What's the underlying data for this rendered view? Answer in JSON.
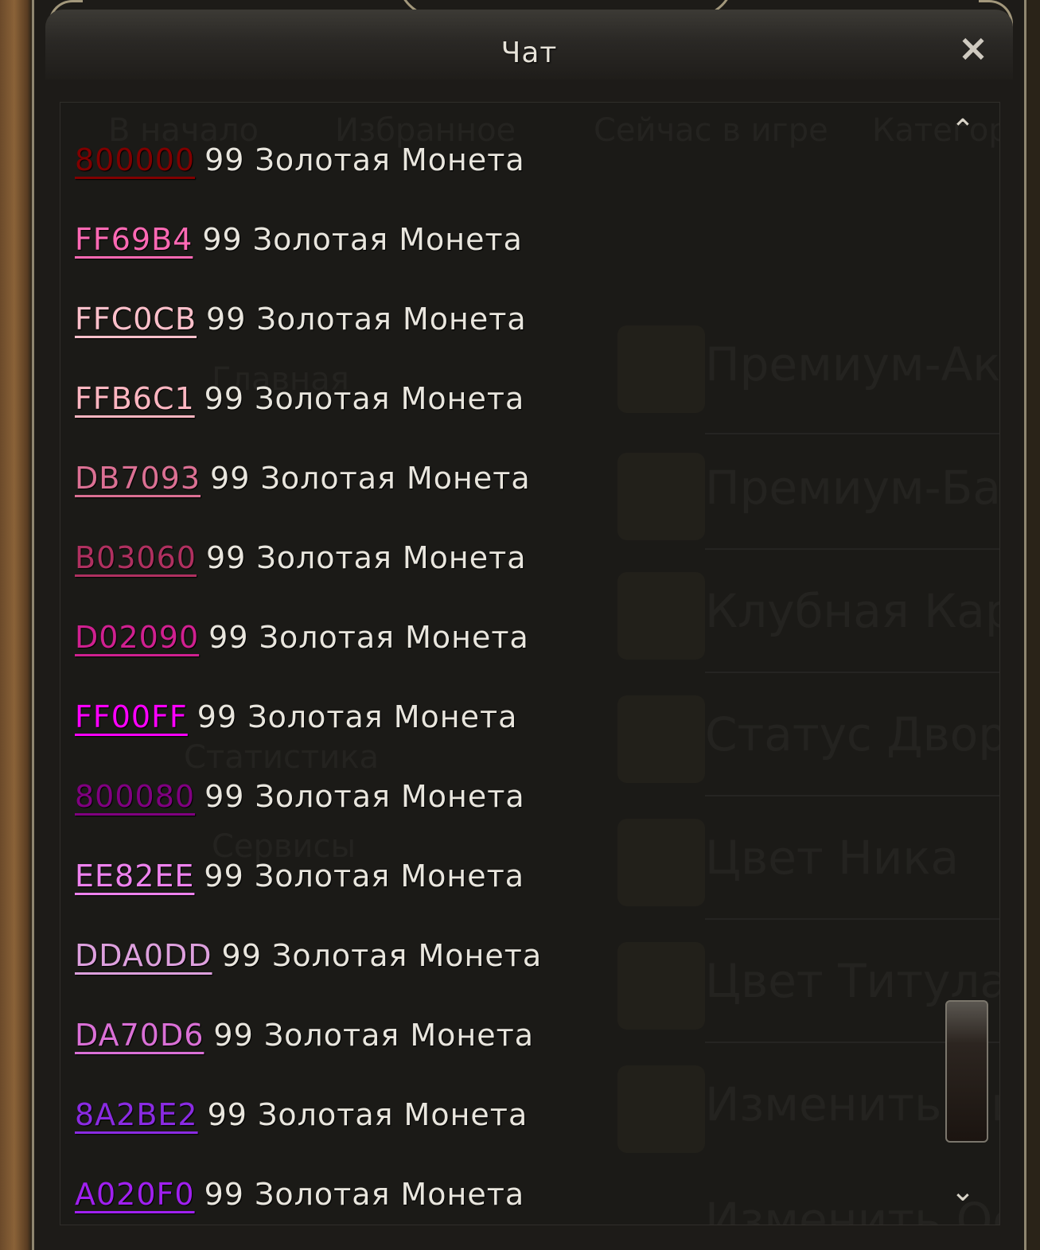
{
  "window": {
    "title": "Чат",
    "close_icon": "×"
  },
  "chat": {
    "lines": [
      {
        "code": "800000",
        "text": "99 Золотая Монета",
        "color": "#800000"
      },
      {
        "code": "FF69B4",
        "text": "99 Золотая Монета",
        "color": "#FF69B4"
      },
      {
        "code": "FFC0CB",
        "text": "99 Золотая Монета",
        "color": "#FFC0CB"
      },
      {
        "code": "FFB6C1",
        "text": "99 Золотая Монета",
        "color": "#FFB6C1"
      },
      {
        "code": "DB7093",
        "text": "99 Золотая Монета",
        "color": "#DB7093"
      },
      {
        "code": "B03060",
        "text": "99 Золотая Монета",
        "color": "#B03060"
      },
      {
        "code": "D02090",
        "text": "99 Золотая Монета",
        "color": "#D02090"
      },
      {
        "code": "FF00FF",
        "text": "99 Золотая Монета",
        "color": "#FF00FF"
      },
      {
        "code": "800080",
        "text": "99 Золотая Монета",
        "color": "#800080"
      },
      {
        "code": "EE82EE",
        "text": "99 Золотая Монета",
        "color": "#EE82EE"
      },
      {
        "code": "DDA0DD",
        "text": "99 Золотая Монета",
        "color": "#DDA0DD"
      },
      {
        "code": "DA70D6",
        "text": "99 Золотая Монета",
        "color": "#DA70D6"
      },
      {
        "code": "8A2BE2",
        "text": "99 Золотая Монета",
        "color": "#8A2BE2"
      },
      {
        "code": "A020F0",
        "text": "99 Золотая Монета",
        "color": "#A020F0"
      }
    ],
    "scroll_up_icon": "⌃",
    "scroll_down_icon": "⌄"
  },
  "background_menu": {
    "tabs": [
      "В начало",
      "Избранное",
      "Сейчас в игре",
      "Категории"
    ],
    "left_items": [
      "Главная",
      "Статистика",
      "Сервисы"
    ],
    "right_items": [
      "Премиум-Аккаунт",
      "Премиум-Бафф",
      "Клубная Карта",
      "Статус Дворянина",
      "Цвет Ника",
      "Цвет Титула",
      "Изменить Ник",
      "Изменить Оск"
    ]
  },
  "colors": {
    "frame": "#8f8670",
    "text": "#e9e6de",
    "window_bg": "#1b1a17"
  }
}
